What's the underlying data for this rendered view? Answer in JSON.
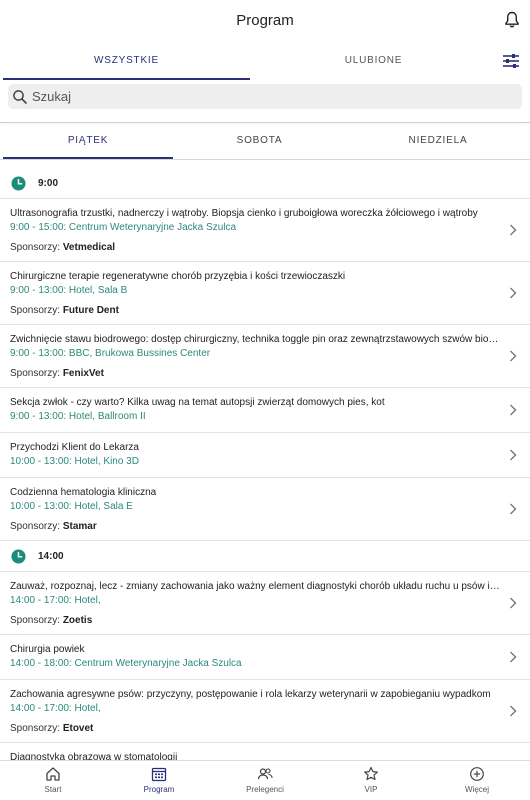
{
  "header": {
    "title": "Program"
  },
  "top_tabs": [
    {
      "label": "WSZYSTKIE",
      "active": true
    },
    {
      "label": "ULUBIONE",
      "active": false
    }
  ],
  "search": {
    "placeholder": "Szukaj",
    "value": ""
  },
  "day_tabs": [
    {
      "label": "PIĄTEK",
      "active": true
    },
    {
      "label": "SOBOTA",
      "active": false
    },
    {
      "label": "NIEDZIELA",
      "active": false
    }
  ],
  "sponsor_prefix": "Sponsorzy:",
  "groups": [
    {
      "time": "9:00",
      "sessions": [
        {
          "title": "Ultrasonografia trzustki, nadnerczy i wątroby. Biopsja cienko i gruboigłowa woreczka żółciowego i wątroby",
          "location": "9:00 - 15:00: Centrum Weterynaryjne Jacka Szulca",
          "sponsor": "Vetmedical"
        },
        {
          "title": "Chirurgiczne terapie regeneratywne chorób przyzębia i kości trzewioczaszki",
          "location": "9:00 - 13:00: Hotel, Sala B",
          "sponsor": "Future Dent"
        },
        {
          "title": "Zwichnięcie stawu biodrowego: dostęp chirurgiczny, technika toggle pin oraz zewnątrzstawowych szwów biodr...",
          "location": "9:00 - 13:00: BBC, Brukowa Bussines Center",
          "sponsor": "FenixVet"
        },
        {
          "title": "Sekcja zwłok - czy warto? Kilka uwag na temat autopsji zwierząt domowych pies, kot",
          "location": "9:00 - 13:00: Hotel, Ballroom II",
          "sponsor": ""
        },
        {
          "title": "Przychodzi Klient do Lekarza",
          "location": "10:00 - 13:00: Hotel, Kino 3D",
          "sponsor": ""
        },
        {
          "title": "Codzienna hematologia kliniczna",
          "location": "10:00 - 13:00: Hotel, Sala E",
          "sponsor": "Stamar"
        }
      ]
    },
    {
      "time": "14:00",
      "sessions": [
        {
          "title": "Zauważ, rozpoznaj, lecz - zmiany zachowania jako ważny element diagnostyki chorób układu ruchu u psów i kot...",
          "location": "14:00 - 17:00: Hotel,",
          "sponsor": "Zoetis"
        },
        {
          "title": "Chirurgia powiek",
          "location": "14:00 - 18:00: Centrum Weterynaryjne Jacka Szulca",
          "sponsor": ""
        },
        {
          "title": "Zachowania agresywne psów: przyczyny, postępowanie i rola lekarzy weterynarii w zapobieganiu wypadkom",
          "location": "14:00 - 17:00: Hotel,",
          "sponsor": "Etovet"
        },
        {
          "title": "Diagnostyka obrazowa w stomatologii",
          "location": "",
          "sponsor": ""
        }
      ]
    }
  ],
  "bottom_nav": [
    {
      "label": "Start",
      "icon": "home-icon",
      "active": false
    },
    {
      "label": "Program",
      "icon": "calendar-icon",
      "active": true
    },
    {
      "label": "Prelegenci",
      "icon": "speakers-icon",
      "active": false
    },
    {
      "label": "VIP",
      "icon": "star-icon",
      "active": false
    },
    {
      "label": "Więcej",
      "icon": "plus-circle-icon",
      "active": false
    }
  ],
  "colors": {
    "accent": "#2b2f7a",
    "teal": "#1e8c7a",
    "location_text": "#2a8a7a"
  }
}
